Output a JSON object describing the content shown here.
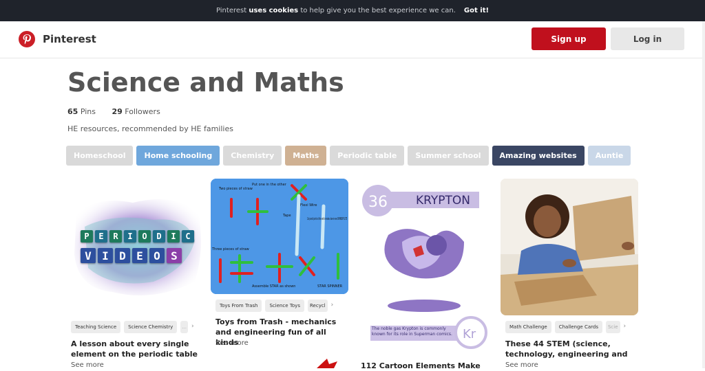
{
  "cookie": {
    "prefix": "Pinterest",
    "bold": "uses cookies",
    "suffix": "to help give you the best experience we can.",
    "button": "Got it!"
  },
  "header": {
    "brand": "Pinterest",
    "signup": "Sign up",
    "login": "Log in"
  },
  "board": {
    "title": "Science and Maths",
    "pins_count": "65",
    "pins_label": "Pins",
    "followers_count": "29",
    "followers_label": "Followers",
    "description": "HE resources, recommended by HE families",
    "tags": [
      {
        "label": "Homeschool",
        "bg": "#d9d9d9",
        "fg": "#ffffff"
      },
      {
        "label": "Home schooling",
        "bg": "#6fa7dc",
        "fg": "#ffffff"
      },
      {
        "label": "Chemistry",
        "bg": "#dadada",
        "fg": "#ffffff"
      },
      {
        "label": "Maths",
        "bg": "#cfb193",
        "fg": "#ffffff"
      },
      {
        "label": "Periodic table",
        "bg": "#dadada",
        "fg": "#ffffff"
      },
      {
        "label": "Summer school",
        "bg": "#dadada",
        "fg": "#ffffff"
      },
      {
        "label": "Amazing websites",
        "bg": "#3a4663",
        "fg": "#ffffff"
      },
      {
        "label": "Auntie",
        "bg": "#c9d7e8",
        "fg": "#ffffff"
      }
    ]
  },
  "pins": [
    {
      "chips": [
        "Teaching Science",
        "Science Chemistry",
        "..."
      ],
      "title": "A lesson about every single element on the periodic table",
      "see_more": "See more",
      "image": {
        "line1": "PERIODIC",
        "line2": "VIDEOS"
      }
    },
    {
      "chips": [
        "Toys From Trash",
        "Science Toys",
        "Recycl"
      ],
      "title": "Toys from Trash - mechanics and engineering fun of all kinds",
      "see_more": "See more",
      "image": {
        "label1": "Two pieces of straw",
        "label2": "Put one in the other",
        "label3": "Tape",
        "label4": "Flexi Wire",
        "label5": "Cut pencil point at this end to make a two-in-one SPINNER FLUTE",
        "label6": "Three pieces of straw",
        "label7": "Assemble STAR as shown",
        "label8": "STAR SPINNER"
      }
    },
    {
      "title": "112 Cartoon Elements Make",
      "image": {
        "number": "36",
        "name": "KRYPTON",
        "caption": "The noble gas Krypton is commonly known for its role in Superman comics.",
        "symbol": "Kr"
      }
    },
    {
      "chips": [
        "Math Challenge",
        "Challenge Cards",
        "Scie"
      ],
      "title": "These 44 STEM (science, technology, engineering and",
      "see_more": "See more"
    }
  ]
}
